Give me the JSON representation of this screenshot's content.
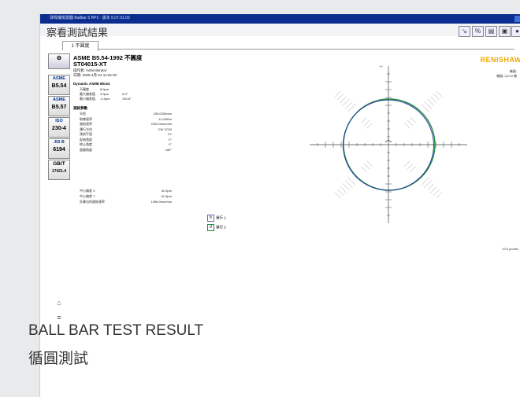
{
  "window": {
    "titlebar_text": "球桿儀檢測器 Ballbar 5 RP2 · 版本 5.07.01.03",
    "page_title": "察看測試結果"
  },
  "toolbar": {
    "icons": [
      "plot-icon",
      "percent-icon",
      "print-icon",
      "save-icon",
      "globe-icon"
    ]
  },
  "tabs": [
    {
      "label": "1 不圓度"
    }
  ],
  "sidebar": {
    "standards": [
      {
        "line1": "ASME",
        "line2": "B5.54"
      },
      {
        "line1": "ASME",
        "line2": "B5.57"
      },
      {
        "line1": "ISO",
        "line2": "230-4"
      },
      {
        "line1": "JIS B",
        "line2": "6194"
      },
      {
        "line1": "GB/T",
        "line2": "17421.4"
      }
    ]
  },
  "report": {
    "title": "ASME B5.54-1992 不圓度",
    "machine": "ST04015-XT",
    "operator": "操作者: Administrator",
    "date": "日期: 2006-4月-24 11:04:30",
    "brand": "RENISHAW",
    "brand_sub1": "機器:",
    "brand_sub2": "機器: QC10 機",
    "dynamic_title": "Dynamic ASME B5.54",
    "results": [
      {
        "label": "不圓度",
        "v1": "8.9μm",
        "v2": "",
        "v3": ""
      },
      {
        "label": "最大偏差值",
        "v1": "3.9μm",
        "v2": "0.0°",
        "v3": ""
      },
      {
        "label": "最小偏差值",
        "v1": "-4.9μm",
        "v2": "190.8°",
        "v3": ""
      }
    ],
    "params_title": "測試參數",
    "params": [
      {
        "label": "半徑",
        "value": "150.0000mm"
      },
      {
        "label": "取樣速率",
        "value": "11.000Hz"
      },
      {
        "label": "進給速率",
        "value": "2000.0mm/min"
      },
      {
        "label": "運行方向",
        "value": "CW CCW"
      },
      {
        "label": "測試平面",
        "value": "XY"
      },
      {
        "label": "起始角度",
        "value": "0°"
      },
      {
        "label": "終止角度",
        "value": "0°"
      },
      {
        "label": "超越角度",
        "value": "180°"
      }
    ],
    "center_rows": [
      {
        "label": "中心偏差 X",
        "value": "41.0μm"
      },
      {
        "label": "中心偏差 Y",
        "value": "-11.5μm"
      },
      {
        "label": "計算出的進給速率",
        "value": "1996.0mm/min"
      }
    ],
    "legend": [
      {
        "label": "運行 1"
      },
      {
        "label": "運行 2"
      }
    ],
    "scale_label": "10.0 μm/div",
    "axis_label": "+Y",
    "axis_label_x": "+X"
  },
  "chart_data": {
    "type": "polar-circle",
    "title": "",
    "series": [
      {
        "name": "運行 1",
        "color": "#1f8a3a"
      },
      {
        "name": "運行 2",
        "color": "#2b3fa8"
      }
    ]
  },
  "captions": {
    "line1": "BALL BAR TEST RESULT",
    "line2": "循圓測試"
  },
  "colors": {
    "titlebar": "#0b2d8f",
    "brand": "#f0a800",
    "run1": "#1f8a3a",
    "run2": "#2b3fa8"
  }
}
